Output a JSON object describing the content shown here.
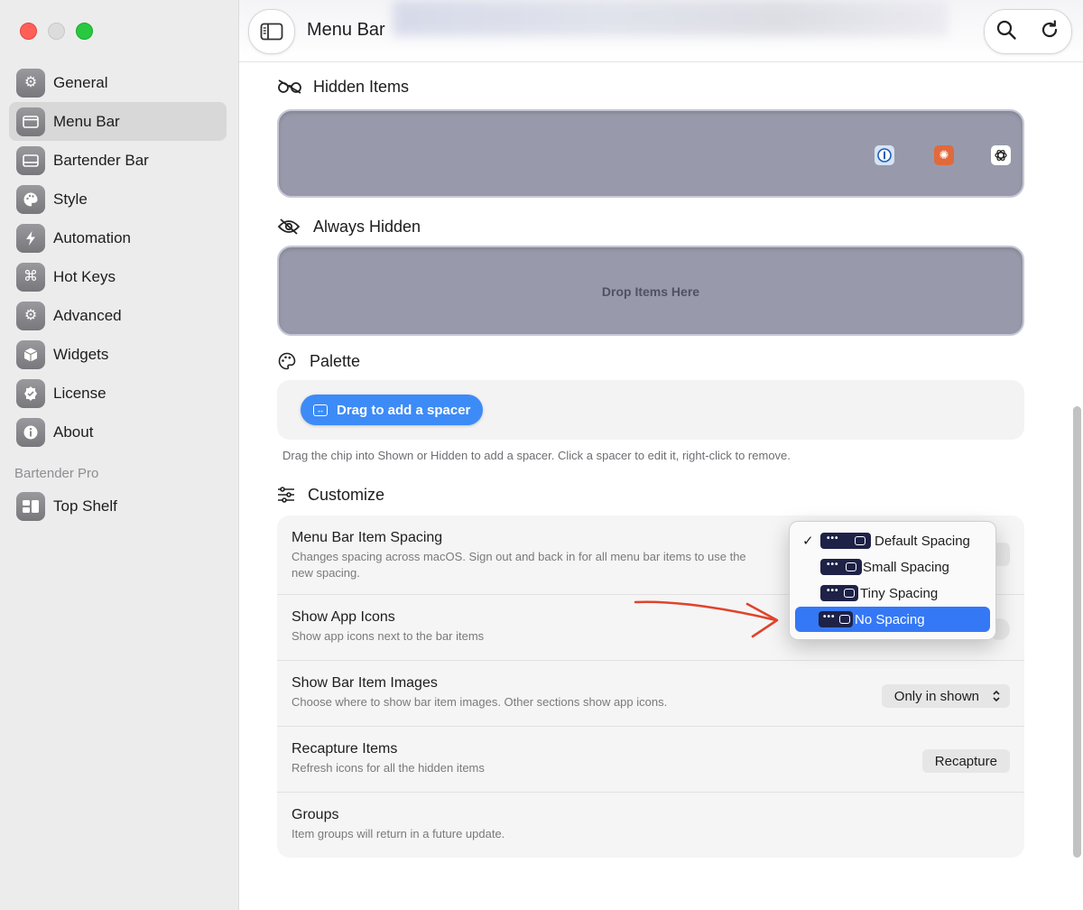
{
  "window": {
    "title": "Menu Bar"
  },
  "sidebar": {
    "items": [
      {
        "label": "General",
        "icon": "gear-icon"
      },
      {
        "label": "Menu Bar",
        "icon": "menubar-icon",
        "selected": true
      },
      {
        "label": "Bartender Bar",
        "icon": "bartender-bar-icon"
      },
      {
        "label": "Style",
        "icon": "palette-icon"
      },
      {
        "label": "Automation",
        "icon": "bolt-icon"
      },
      {
        "label": "Hot Keys",
        "icon": "command-icon"
      },
      {
        "label": "Advanced",
        "icon": "gears-icon"
      },
      {
        "label": "Widgets",
        "icon": "cube-icon"
      },
      {
        "label": "License",
        "icon": "badge-check-icon"
      },
      {
        "label": "About",
        "icon": "info-icon"
      }
    ],
    "section_label": "Bartender Pro",
    "pro_items": [
      {
        "label": "Top Shelf",
        "icon": "top-shelf-icon"
      }
    ]
  },
  "sections": {
    "hidden": {
      "title": "Hidden Items"
    },
    "always_hidden": {
      "title": "Always Hidden",
      "drop_text": "Drop Items Here"
    },
    "palette": {
      "title": "Palette",
      "chip_label": "Drag to add a spacer",
      "hint": "Drag the chip into Shown or Hidden to add a spacer. Click a spacer to edit it, right-click to remove."
    },
    "customize": {
      "title": "Customize"
    }
  },
  "settings": {
    "spacing": {
      "title": "Menu Bar Item Spacing",
      "desc": "Changes spacing across macOS. Sign out and back in for all menu bar items to use the new spacing."
    },
    "app_icons": {
      "title": "Show App Icons",
      "desc": "Show app icons next to the bar items"
    },
    "bar_images": {
      "title": "Show Bar Item Images",
      "desc": "Choose where to show bar item images. Other sections show app icons.",
      "value": "Only in shown"
    },
    "recapture": {
      "title": "Recapture Items",
      "desc": "Refresh icons for all the hidden items",
      "button": "Recapture"
    },
    "groups": {
      "title": "Groups",
      "desc": "Item groups will return in a future update."
    }
  },
  "spacing_menu": {
    "options": [
      "Default Spacing",
      "Small Spacing",
      "Tiny Spacing",
      "No Spacing"
    ],
    "checked": "Default Spacing",
    "highlighted": "No Spacing",
    "check_mark": "✓"
  },
  "colors": {
    "accent": "#3478f6",
    "annotation": "#e0432b",
    "tray": "#989aab"
  }
}
